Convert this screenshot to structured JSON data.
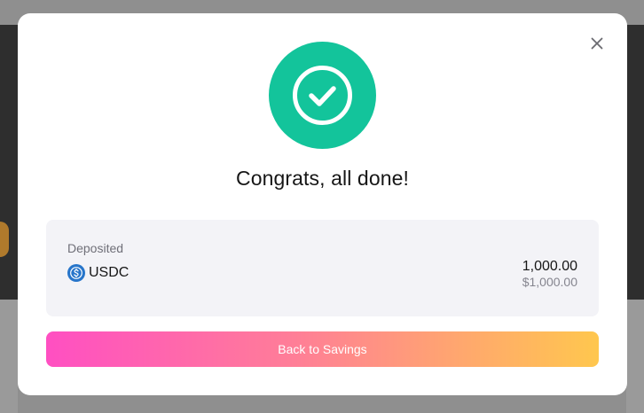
{
  "modal": {
    "title": "Congrats, all done!",
    "close_icon": "close-icon",
    "success_icon": "checkmark-circle-icon",
    "accent_color": "#13c49b"
  },
  "deposit": {
    "label": "Deposited",
    "asset": "USDC",
    "asset_icon": "usdc-icon",
    "amount": "1,000.00",
    "amount_usd": "$1,000.00"
  },
  "cta": {
    "label": "Back to Savings",
    "gradient_colors": [
      "#ff4fc2",
      "#ff7e97",
      "#ffa76e",
      "#ffc74e"
    ]
  }
}
